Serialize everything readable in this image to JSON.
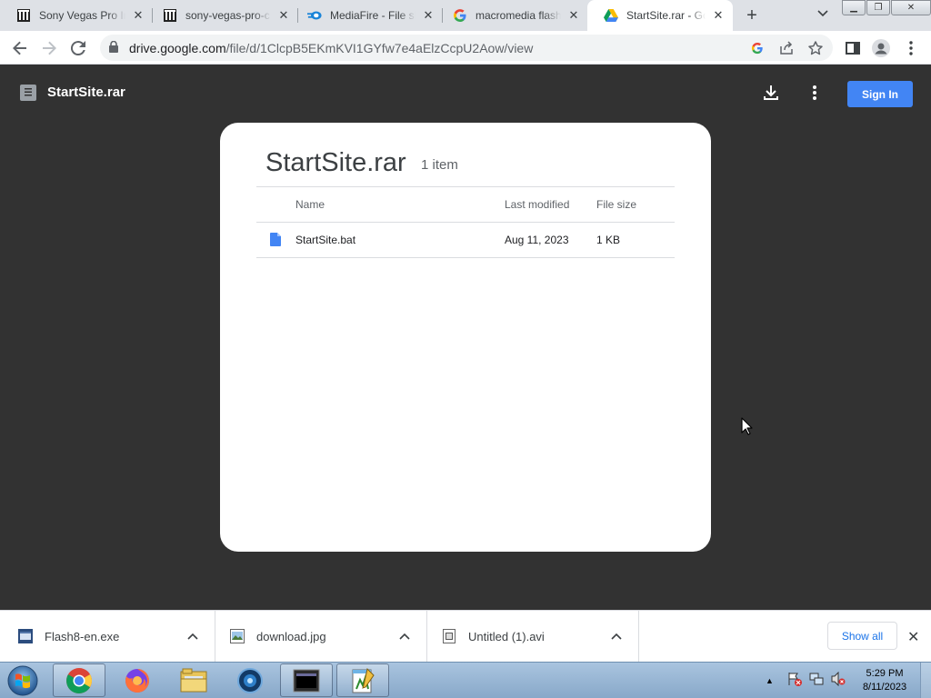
{
  "browser": {
    "tabs": [
      {
        "title": "Sony Vegas Pro Ir",
        "icon": "archive-icon",
        "active": false
      },
      {
        "title": "sony-vegas-pro-c",
        "icon": "archive-icon",
        "active": false
      },
      {
        "title": "MediaFire - File sl",
        "icon": "mediafire-icon",
        "active": false
      },
      {
        "title": "macromedia flash",
        "icon": "google-icon",
        "active": false
      },
      {
        "title": "StartSite.rar - Goo",
        "icon": "google-drive-icon",
        "active": true
      }
    ],
    "url_host": "drive.google.com",
    "url_path": "/file/d/1ClcpB5EKmKVI1GYfw7e4aElzCcpU2Aow/view"
  },
  "viewer": {
    "file_name": "StartSite.rar",
    "sign_in_label": "Sign In"
  },
  "archive": {
    "title": "StartSite.rar",
    "item_count": "1 item",
    "columns": {
      "name": "Name",
      "modified": "Last modified",
      "size": "File size"
    },
    "rows": [
      {
        "name": "StartSite.bat",
        "modified": "Aug 11, 2023",
        "size": "1 KB"
      }
    ]
  },
  "downloads": {
    "items": [
      {
        "name": "Flash8-en.exe",
        "icon": "exe-file-icon"
      },
      {
        "name": "download.jpg",
        "icon": "image-file-icon"
      },
      {
        "name": "Untitled (1).avi",
        "icon": "video-file-icon"
      }
    ],
    "show_all_label": "Show all"
  },
  "taskbar": {
    "apps": [
      "chrome",
      "firefox",
      "file-explorer",
      "media-player",
      "terminal",
      "notepad"
    ],
    "time": "5:29 PM",
    "date": "8/11/2023"
  },
  "colors": {
    "viewer_bg": "#323232",
    "accent": "#4285f4",
    "tab_strip": "#dee1e6"
  }
}
